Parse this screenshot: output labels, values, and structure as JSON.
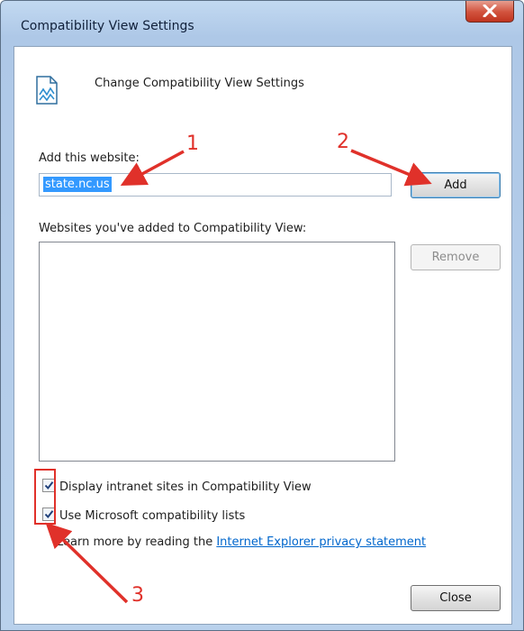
{
  "window": {
    "title": "Compatibility View Settings"
  },
  "header": {
    "text": "Change Compatibility View Settings",
    "icon": "compat-view-icon"
  },
  "add_site": {
    "label": "Add this website:",
    "value": "state.nc.us",
    "button": "Add"
  },
  "site_list": {
    "label": "Websites you've added to Compatibility View:",
    "items": [],
    "remove_button": "Remove"
  },
  "options": [
    {
      "label": "Display intranet sites in Compatibility View",
      "checked": true
    },
    {
      "label": "Use Microsoft compatibility lists",
      "checked": true
    }
  ],
  "learn_more": {
    "text": "Learn more by reading the",
    "link": "Internet Explorer privacy statement"
  },
  "footer": {
    "close_button": "Close"
  },
  "annotations": {
    "marker1": "1",
    "marker2": "2",
    "marker3": "3",
    "color": "#e0312a"
  },
  "colors": {
    "selection": "#3399ff",
    "link": "#0066cc",
    "title_bg": "#b9d1ec"
  }
}
